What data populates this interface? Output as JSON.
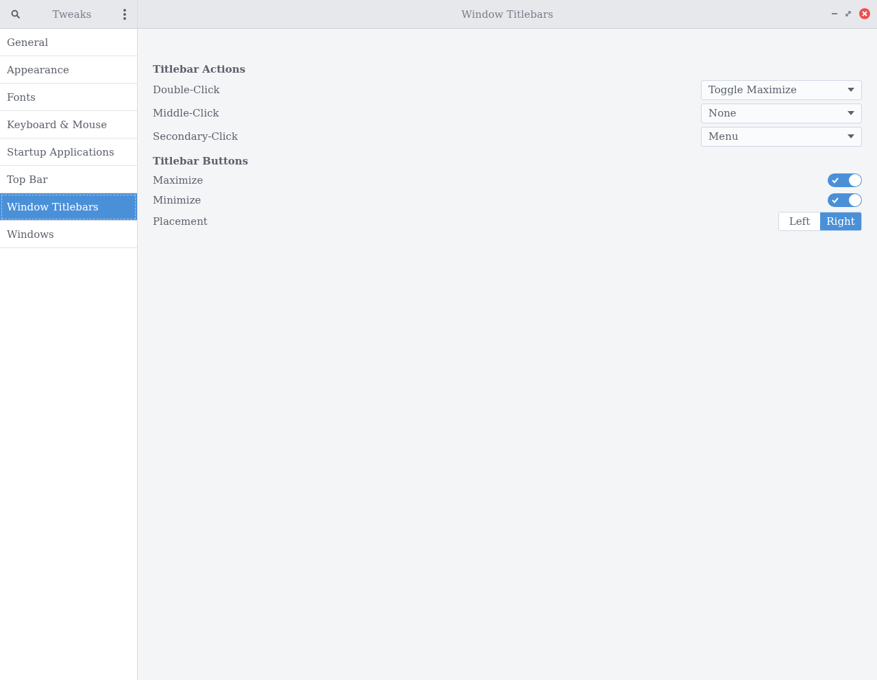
{
  "sidebar": {
    "title": "Tweaks",
    "items": [
      {
        "label": "General",
        "selected": false
      },
      {
        "label": "Appearance",
        "selected": false
      },
      {
        "label": "Fonts",
        "selected": false
      },
      {
        "label": "Keyboard & Mouse",
        "selected": false
      },
      {
        "label": "Startup Applications",
        "selected": false
      },
      {
        "label": "Top Bar",
        "selected": false
      },
      {
        "label": "Window Titlebars",
        "selected": true
      },
      {
        "label": "Windows",
        "selected": false
      }
    ]
  },
  "window": {
    "title": "Window Titlebars"
  },
  "sections": [
    {
      "heading": "Titlebar Actions",
      "rows": [
        {
          "kind": "dropdown",
          "label": "Double-Click",
          "value": "Toggle Maximize"
        },
        {
          "kind": "dropdown",
          "label": "Middle-Click",
          "value": "None"
        },
        {
          "kind": "dropdown",
          "label": "Secondary-Click",
          "value": "Menu"
        }
      ]
    },
    {
      "heading": "Titlebar Buttons",
      "rows": [
        {
          "kind": "switch",
          "label": "Maximize",
          "on": true
        },
        {
          "kind": "switch",
          "label": "Minimize",
          "on": true
        },
        {
          "kind": "segmented",
          "label": "Placement",
          "options": [
            {
              "label": "Left",
              "selected": false
            },
            {
              "label": "Right",
              "selected": true
            }
          ]
        }
      ]
    }
  ]
}
